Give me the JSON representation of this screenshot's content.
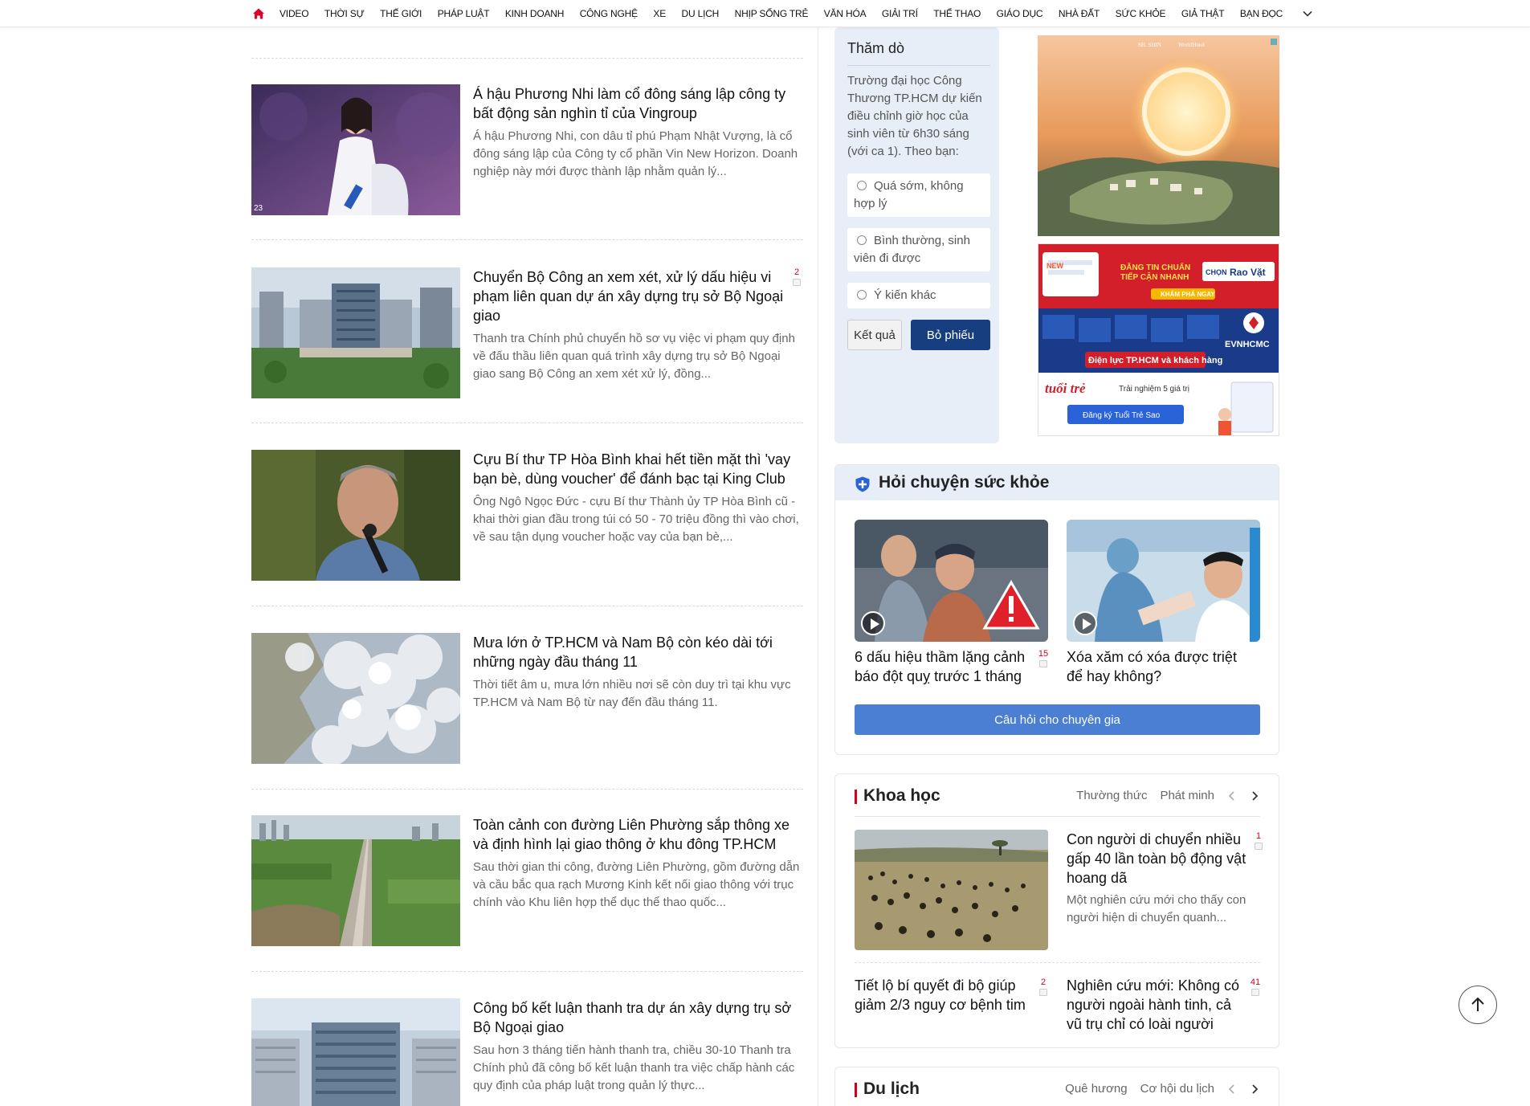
{
  "nav": {
    "items": [
      "VIDEO",
      "THỜI SỰ",
      "THẾ GIỚI",
      "PHÁP LUẬT",
      "KINH DOANH",
      "CÔNG NGHỆ",
      "XE",
      "DU LỊCH",
      "NHỊP SỐNG TRẺ",
      "VĂN HÓA",
      "GIẢI TRÍ",
      "THỂ THAO",
      "GIÁO DỤC",
      "NHÀ ĐẤT",
      "SỨC KHỎE",
      "GIẢ THẬT",
      "BẠN ĐỌC"
    ],
    "accent_color": "#e4002b"
  },
  "articles": [
    {
      "title": "Á hậu Phương Nhi làm cổ đông sáng lập công ty bất động sản nghìn tỉ của Vingroup",
      "summary": "Á hậu Phương Nhi, con dâu tỉ phú Phạm Nhật Vượng, là cổ đông sáng lập của Công ty cổ phần Vin New Horizon. Doanh nghiệp này mới được thành lập nhằm quản lý...",
      "comments": "",
      "image_caption": "23"
    },
    {
      "title": "Chuyển Bộ Công an xem xét, xử lý dấu hiệu vi phạm liên quan dự án xây dựng trụ sở Bộ Ngoại giao",
      "summary": "Thanh tra Chính phủ chuyển hồ sơ vụ việc vi phạm quy định về đấu thầu liên quan quá trình xây dựng trụ sở Bộ Ngoại giao sang Bộ Công an xem xét xử lý, đồng...",
      "comments": "2"
    },
    {
      "title": "Cựu Bí thư TP Hòa Bình khai hết tiền mặt thì 'vay bạn bè, dùng voucher' để đánh bạc tại King Club",
      "summary": "Ông Ngô Ngọc Đức - cựu Bí thư Thành ủy TP Hòa Bình cũ - khai thời gian đầu trong túi có 50 - 70 triệu đồng thì vào chơi, về sau tận dụng voucher hoặc vay của bạn bè,...",
      "comments": ""
    },
    {
      "title": "Mưa lớn ở TP.HCM và Nam Bộ còn kéo dài tới những ngày đầu tháng 11",
      "summary": "Thời tiết âm u, mưa lớn nhiều nơi sẽ còn duy trì tại khu vực TP.HCM và Nam Bộ từ nay đến đầu tháng 11.",
      "comments": ""
    },
    {
      "title": "Toàn cảnh con đường Liên Phường sắp thông xe và định hình lại giao thông ở khu đông TP.HCM",
      "summary": "Sau thời gian thi công, đường Liên Phường, gồm đường dẫn và cầu bắc qua rạch Mương Kinh kết nối giao thông với trục chính vào Khu liên hợp thể dục thể thao quốc...",
      "comments": ""
    },
    {
      "title": "Công bố kết luận thanh tra dự án xây dựng trụ sở Bộ Ngoại giao",
      "summary": "Sau hơn 3 tháng tiến hành thanh tra, chiều 30-10 Thanh tra Chính phủ đã công bố kết luận thanh tra việc chấp hành các quy định của pháp luật trong quản lý thực...",
      "comments": ""
    }
  ],
  "poll": {
    "title": "Thăm dò",
    "question": "Trường đại học Công Thương TP.HCM dự kiến điều chỉnh giờ học của sinh viên từ 6h30 sáng (với ca 1). Theo bạn:",
    "options": [
      "Quá sớm, không hợp lý",
      "Bình thường, sinh viên đi được",
      "Ý kiến khác"
    ],
    "result_label": "Kết quả",
    "vote_label": "Bỏ phiếu"
  },
  "ads": {
    "ad1_brands": [
      "",
      "SH. SHIN",
      "WorldHotel"
    ],
    "ad2": {
      "banner_new": "NEW",
      "banner_line1": "ĐĂNG TIN CHUẨN",
      "banner_line2": "TIẾP CẬN NHANH",
      "banner_choose": "CHỌN",
      "banner_brand": "Rao Vặt",
      "banner_cta": "KHÁM PHÁ NGAY",
      "evn_brand": "EVNHCMC",
      "evn_caption": "Điện lực TP.HCM và khách hàng",
      "tuoitre_logo": "tuổi trẻ",
      "tuoitre_text": "Trải nghiệm 5 giá trị",
      "tuoitre_cta": "Đăng ký Tuổi Trẻ Sao"
    }
  },
  "health": {
    "title": "Hỏi chuyện sức khỏe",
    "cards": [
      {
        "title": "6 dấu hiệu thầm lặng cảnh báo đột quỵ trước 1 tháng",
        "comments": "15"
      },
      {
        "title": "Xóa xăm có xóa được triệt để hay không?",
        "comments": ""
      }
    ],
    "button": "Câu hỏi cho chuyên gia"
  },
  "science": {
    "title": "Khoa học",
    "tabs": [
      "Thường thức",
      "Phát minh"
    ],
    "main": {
      "title": "Con người di chuyển nhiều gấp 40 lần toàn bộ động vật hoang dã",
      "summary": "Một nghiên cứu mới cho thấy con người hiện di chuyển quanh...",
      "comments": "1"
    },
    "items": [
      {
        "title": "Tiết lộ bí quyết đi bộ giúp giảm 2/3 nguy cơ bệnh tim",
        "comments": "2"
      },
      {
        "title": "Nghiên cứu mới: Không có người ngoài hành tinh, cả vũ trụ chỉ có loài người",
        "comments": "41"
      }
    ]
  },
  "travel": {
    "title": "Du lịch",
    "tabs": [
      "Quê hương",
      "Cơ hội du lịch"
    ]
  }
}
